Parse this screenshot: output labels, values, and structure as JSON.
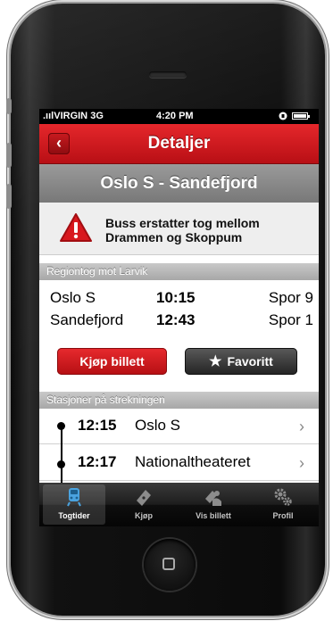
{
  "status_bar": {
    "carrier": "VIRGIN",
    "network": "3G",
    "time": "4:20 PM"
  },
  "nav": {
    "back_label": "‹",
    "title": "Detaljer"
  },
  "route": {
    "title": "Oslo S - Sandefjord"
  },
  "alert": {
    "line1": "Buss erstatter tog mellom",
    "line2": "Drammen og Skoppum"
  },
  "train_section": {
    "header": "Regiontog mot Larvik"
  },
  "departures": [
    {
      "station": "Oslo S",
      "time": "10:15",
      "track": "Spor 9"
    },
    {
      "station": "Sandefjord",
      "time": "12:43",
      "track": "Spor 1"
    }
  ],
  "actions": {
    "buy_label": "Kjøp billett",
    "favorite_label": "Favoritt",
    "favorite_icon": "★"
  },
  "stations_section": {
    "header": "Stasjoner på strekningen"
  },
  "stations": [
    {
      "time": "12:15",
      "name": "Oslo S"
    },
    {
      "time": "12:17",
      "name": "Nationaltheateret"
    }
  ],
  "tabs": [
    {
      "label": "Togtider",
      "icon": "train-icon"
    },
    {
      "label": "Kjøp",
      "icon": "ticket-icon"
    },
    {
      "label": "Vis billett",
      "icon": "show-ticket-icon"
    },
    {
      "label": "Profil",
      "icon": "gears-icon"
    }
  ],
  "colors": {
    "accent": "#d8181e",
    "dark_button": "#2e2e2e",
    "section_gray": "#b5b5b5",
    "tab_active_icon": "#4aa3df"
  }
}
